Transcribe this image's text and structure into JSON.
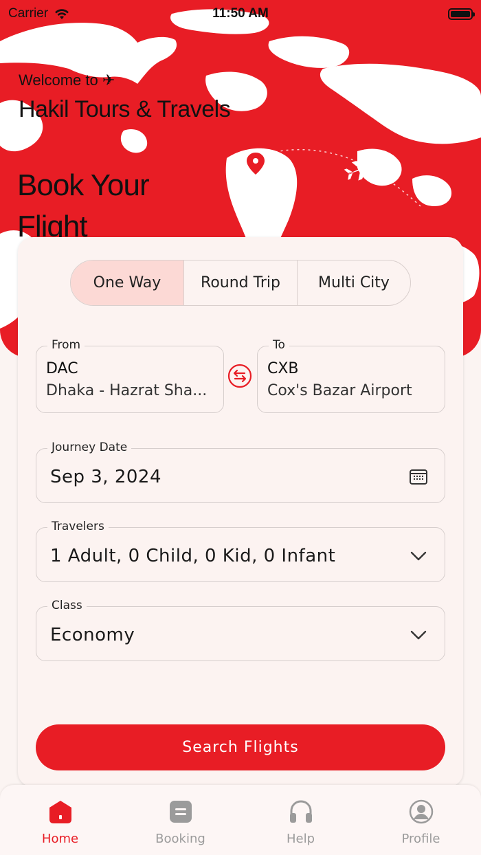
{
  "status_bar": {
    "carrier": "Carrier",
    "time": "11:50 AM"
  },
  "hero": {
    "welcome": "Welcome to ✈",
    "company": "Hakil Tours & Travels",
    "headline_line1": "Book Your",
    "headline_line2": "Flight"
  },
  "trip_types": [
    "One Way",
    "Round Trip",
    "Multi City"
  ],
  "selected_trip_type": "One Way",
  "from": {
    "label": "From",
    "code": "DAC",
    "name": "Dhaka - Hazrat Sha..."
  },
  "to": {
    "label": "To",
    "code": "CXB",
    "name": "Cox's Bazar Airport"
  },
  "journey_date": {
    "label": "Journey Date",
    "value": "Sep 3, 2024"
  },
  "travelers": {
    "label": "Travelers",
    "value": "1 Adult, 0 Child, 0 Kid, 0 Infant"
  },
  "class": {
    "label": "Class",
    "value": "Economy"
  },
  "search_button": "Search Flights",
  "nav": [
    {
      "label": "Home",
      "icon": "home-icon"
    },
    {
      "label": "Booking",
      "icon": "booking-icon"
    },
    {
      "label": "Help",
      "icon": "headset-icon"
    },
    {
      "label": "Profile",
      "icon": "profile-icon"
    }
  ],
  "colors": {
    "accent": "#e81d25",
    "card": "#fcf3f1",
    "segment_selected": "#fcd9d5",
    "nav_inactive": "#9b9b9b"
  }
}
